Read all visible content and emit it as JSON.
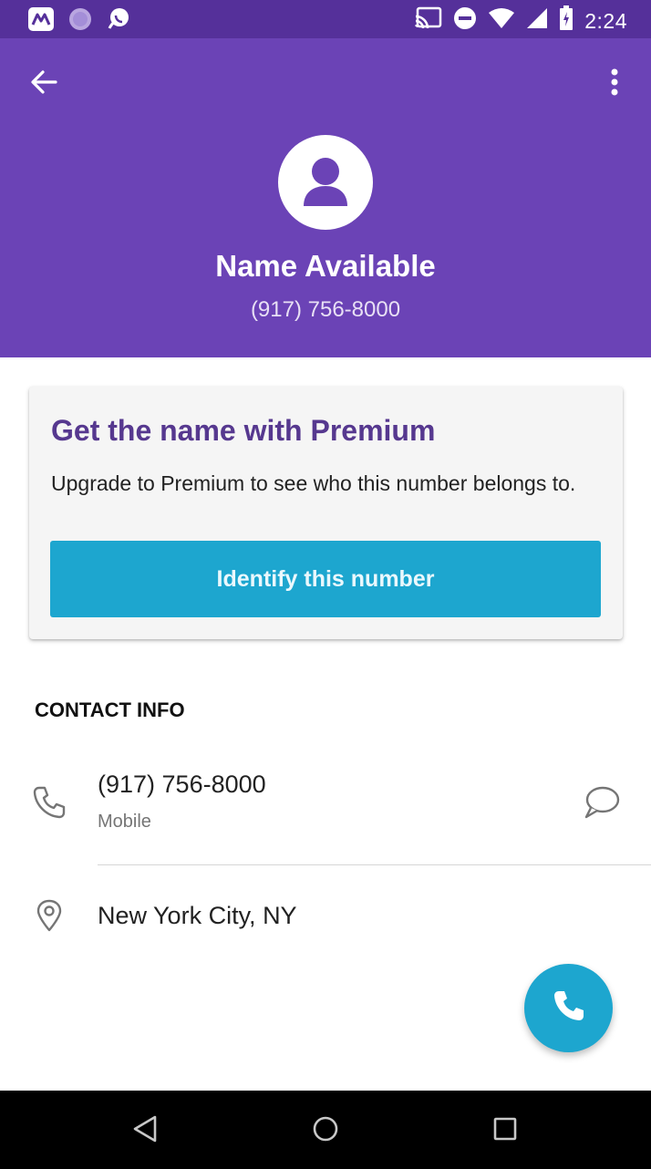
{
  "status_bar": {
    "time": "2:24",
    "left_icons": [
      "app-notification-icon",
      "circle-notification-icon",
      "chat-notification-icon"
    ],
    "right_icons": [
      "cast-icon",
      "do-not-disturb-icon",
      "wifi-icon",
      "cell-signal-icon",
      "battery-icon"
    ]
  },
  "header": {
    "background_color": "#6b43b6",
    "back_icon": "arrow-back-icon",
    "more_icon": "more-vert-icon",
    "avatar_icon": "person-icon",
    "name": "Name Available",
    "number": "(917) 756-8000"
  },
  "premium_card": {
    "title": "Get the name with Premium",
    "description": "Upgrade to Premium to see who this number belongs to.",
    "button_label": "Identify this number",
    "title_color": "#56388f",
    "button_color": "#1da6cf"
  },
  "contact_info": {
    "section_title": "CONTACT INFO",
    "phone": {
      "icon": "phone-icon",
      "value": "(917) 756-8000",
      "type": "Mobile",
      "action_icon": "message-icon"
    },
    "location": {
      "icon": "location-pin-icon",
      "value": "New York City, NY"
    }
  },
  "fab": {
    "icon": "call-icon",
    "color": "#1da6cf"
  },
  "nav_bar": {
    "icons": [
      "back-triangle-icon",
      "home-circle-icon",
      "recents-square-icon"
    ]
  }
}
